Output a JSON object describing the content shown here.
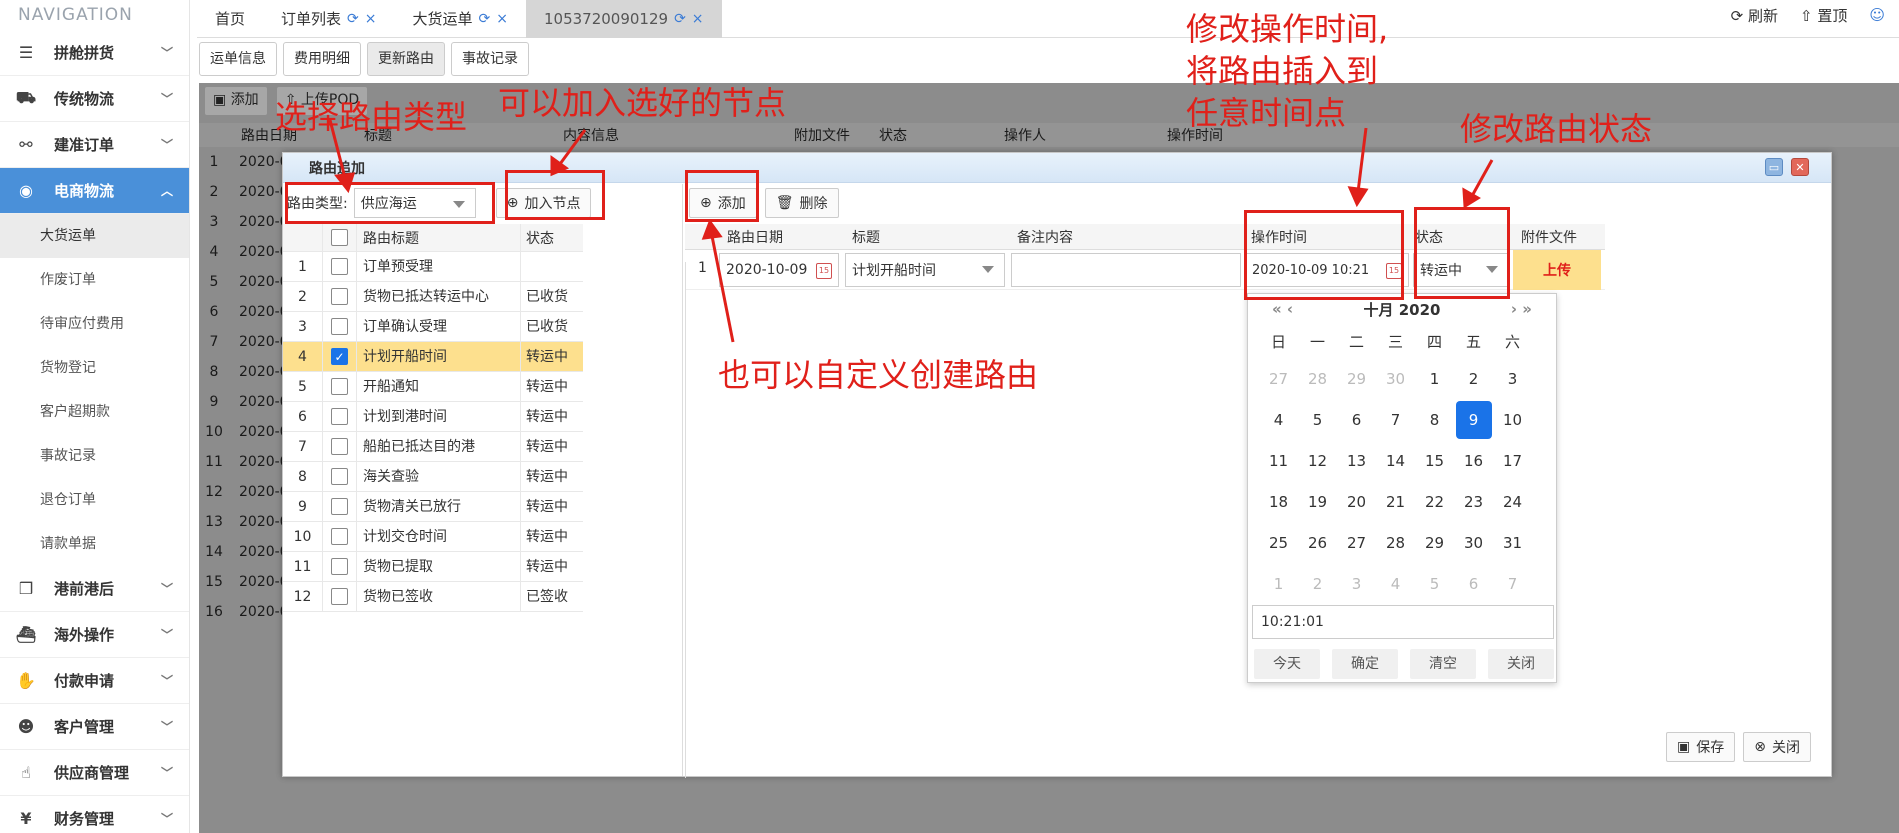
{
  "sidebar": {
    "title": "NAVIGATION",
    "items": [
      {
        "label": "拼舱拼货",
        "icon": "server-icon"
      },
      {
        "label": "传统物流",
        "icon": "truck-icon"
      },
      {
        "label": "建准订单",
        "icon": "link-icon"
      },
      {
        "label": "电商物流",
        "icon": "globe-icon"
      }
    ],
    "sub_items": [
      "大货运单",
      "作废订单",
      "待审应付费用",
      "货物登记",
      "客户超期款",
      "事故记录",
      "退仓订单",
      "请款单据"
    ],
    "items_after": [
      {
        "label": "港前港后",
        "icon": "cubes-icon"
      },
      {
        "label": "海外操作",
        "icon": "ship-icon"
      },
      {
        "label": "付款申请",
        "icon": "handshake-icon"
      },
      {
        "label": "客户管理",
        "icon": "users-icon"
      },
      {
        "label": "供应商管理",
        "icon": "thumbs-up-icon"
      },
      {
        "label": "财务管理",
        "icon": "yen-icon"
      }
    ]
  },
  "topbar": {
    "tabs": [
      "首页",
      "订单列表",
      "大货运单",
      "1053720090129"
    ],
    "refresh": "刷新",
    "pin": "置顶"
  },
  "subtabs": [
    "运单信息",
    "费用明细",
    "更新路由",
    "事故记录"
  ],
  "background": {
    "add": "添加",
    "upload": "上传POD",
    "headers": [
      "路由日期",
      "标题",
      "内容信息",
      "附加文件",
      "状态",
      "操作人",
      "操作时间"
    ],
    "row_numbers": [
      "1",
      "2",
      "3",
      "4",
      "5",
      "6",
      "7",
      "8",
      "9",
      "10",
      "11",
      "12",
      "13",
      "14",
      "15",
      "16"
    ],
    "row_prefix": "2020-0"
  },
  "dialog": {
    "title": "路由追加",
    "route_type_label": "路由类型:",
    "route_type_value": "供应海运",
    "add_node": "加入节点",
    "left_headers": [
      "路由标题",
      "状态"
    ],
    "left_rows": [
      {
        "n": "1",
        "title": "订单预受理",
        "status": ""
      },
      {
        "n": "2",
        "title": "货物已抵达转运中心",
        "status": "已收货"
      },
      {
        "n": "3",
        "title": "订单确认受理",
        "status": "已收货"
      },
      {
        "n": "4",
        "title": "计划开船时间",
        "status": "转运中",
        "checked": true
      },
      {
        "n": "5",
        "title": "开船通知",
        "status": "转运中"
      },
      {
        "n": "6",
        "title": "计划到港时间",
        "status": "转运中"
      },
      {
        "n": "7",
        "title": "船舶已抵达目的港",
        "status": "转运中"
      },
      {
        "n": "8",
        "title": "海关查验",
        "status": "转运中"
      },
      {
        "n": "9",
        "title": "货物清关已放行",
        "status": "转运中"
      },
      {
        "n": "10",
        "title": "计划交仓时间",
        "status": "转运中"
      },
      {
        "n": "11",
        "title": "货物已提取",
        "status": "转运中"
      },
      {
        "n": "12",
        "title": "货物已签收",
        "status": "已签收"
      }
    ],
    "add": "添加",
    "delete": "删除",
    "right_headers": [
      "路由日期",
      "标题",
      "备注内容",
      "操作时间",
      "状态",
      "附件文件"
    ],
    "right_row": {
      "n": "1",
      "date": "2020-10-09",
      "title": "计划开船时间",
      "remark": "",
      "op_time": "2020-10-09 10:21",
      "status": "转运中",
      "upload": "上传"
    },
    "save": "保存",
    "close": "关闭"
  },
  "calendar": {
    "month": "十月 2020",
    "weekdays": [
      "日",
      "一",
      "二",
      "三",
      "四",
      "五",
      "六"
    ],
    "days": [
      [
        "27",
        "28",
        "29",
        "30",
        "1",
        "2",
        "3"
      ],
      [
        "4",
        "5",
        "6",
        "7",
        "8",
        "9",
        "10"
      ],
      [
        "11",
        "12",
        "13",
        "14",
        "15",
        "16",
        "17"
      ],
      [
        "18",
        "19",
        "20",
        "21",
        "22",
        "23",
        "24"
      ],
      [
        "25",
        "26",
        "27",
        "28",
        "29",
        "30",
        "31"
      ],
      [
        "1",
        "2",
        "3",
        "4",
        "5",
        "6",
        "7"
      ]
    ],
    "selected": "9",
    "time": "10:21:01",
    "buttons": [
      "今天",
      "确定",
      "清空",
      "关闭"
    ]
  },
  "annotations": {
    "route_type": "选择路由类型",
    "add_node": "可以加入选好的节点",
    "custom": "也可以自定义创建路由",
    "op_time_1": "修改操作时间,",
    "op_time_2": "将路由插入到",
    "op_time_3": "任意时间点",
    "status": "修改路由状态"
  },
  "colors": {
    "accent": "#4a90d9",
    "annotation": "#e0201a",
    "selected_row": "#fde08e"
  }
}
